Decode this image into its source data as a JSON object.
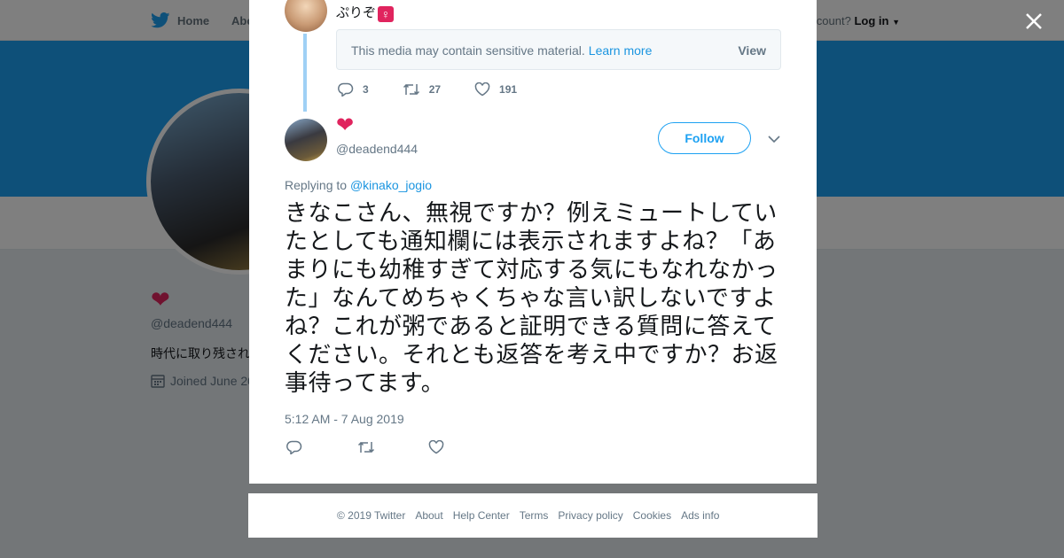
{
  "nav": {
    "home_label": "Home",
    "about_label": "Abo",
    "login_prompt": "ccount?",
    "login_label": "Log in"
  },
  "background_profile": {
    "handle": "@deadend444",
    "bio": "時代に取り残され",
    "joined": "Joined June 20"
  },
  "parent_tweet": {
    "text": "ぷりぞ",
    "sensitive_notice": "This media may contain sensitive material.",
    "learn_more": "Learn more",
    "view_label": "View",
    "replies": "3",
    "retweets": "27",
    "likes": "191"
  },
  "tweet": {
    "name_emoji": "❤",
    "handle": "@deadend444",
    "follow_label": "Follow",
    "replying_prefix": "Replying to",
    "replying_to": "@kinako_jogio",
    "text": "きなこさん、無視ですか？例えミュートしていたとしても通知欄には表示されますよね？「あまりにも幼稚すぎて対応する気にもなれなかった」なんてめちゃくちゃな言い訳しないですよね？これが粥であると証明できる質問に答えてください。それとも返答を考え中ですか？お返事待ってます。",
    "timestamp": "5:12 AM - 7 Aug 2019"
  },
  "footer": {
    "copyright": "© 2019 Twitter",
    "links": [
      "About",
      "Help Center",
      "Terms",
      "Privacy policy",
      "Cookies",
      "Ads info"
    ]
  },
  "colors": {
    "twitter_blue": "#1da1f2",
    "link_blue": "#1b95e0",
    "heart_red": "#e0245e",
    "muted_gray": "#657786"
  }
}
